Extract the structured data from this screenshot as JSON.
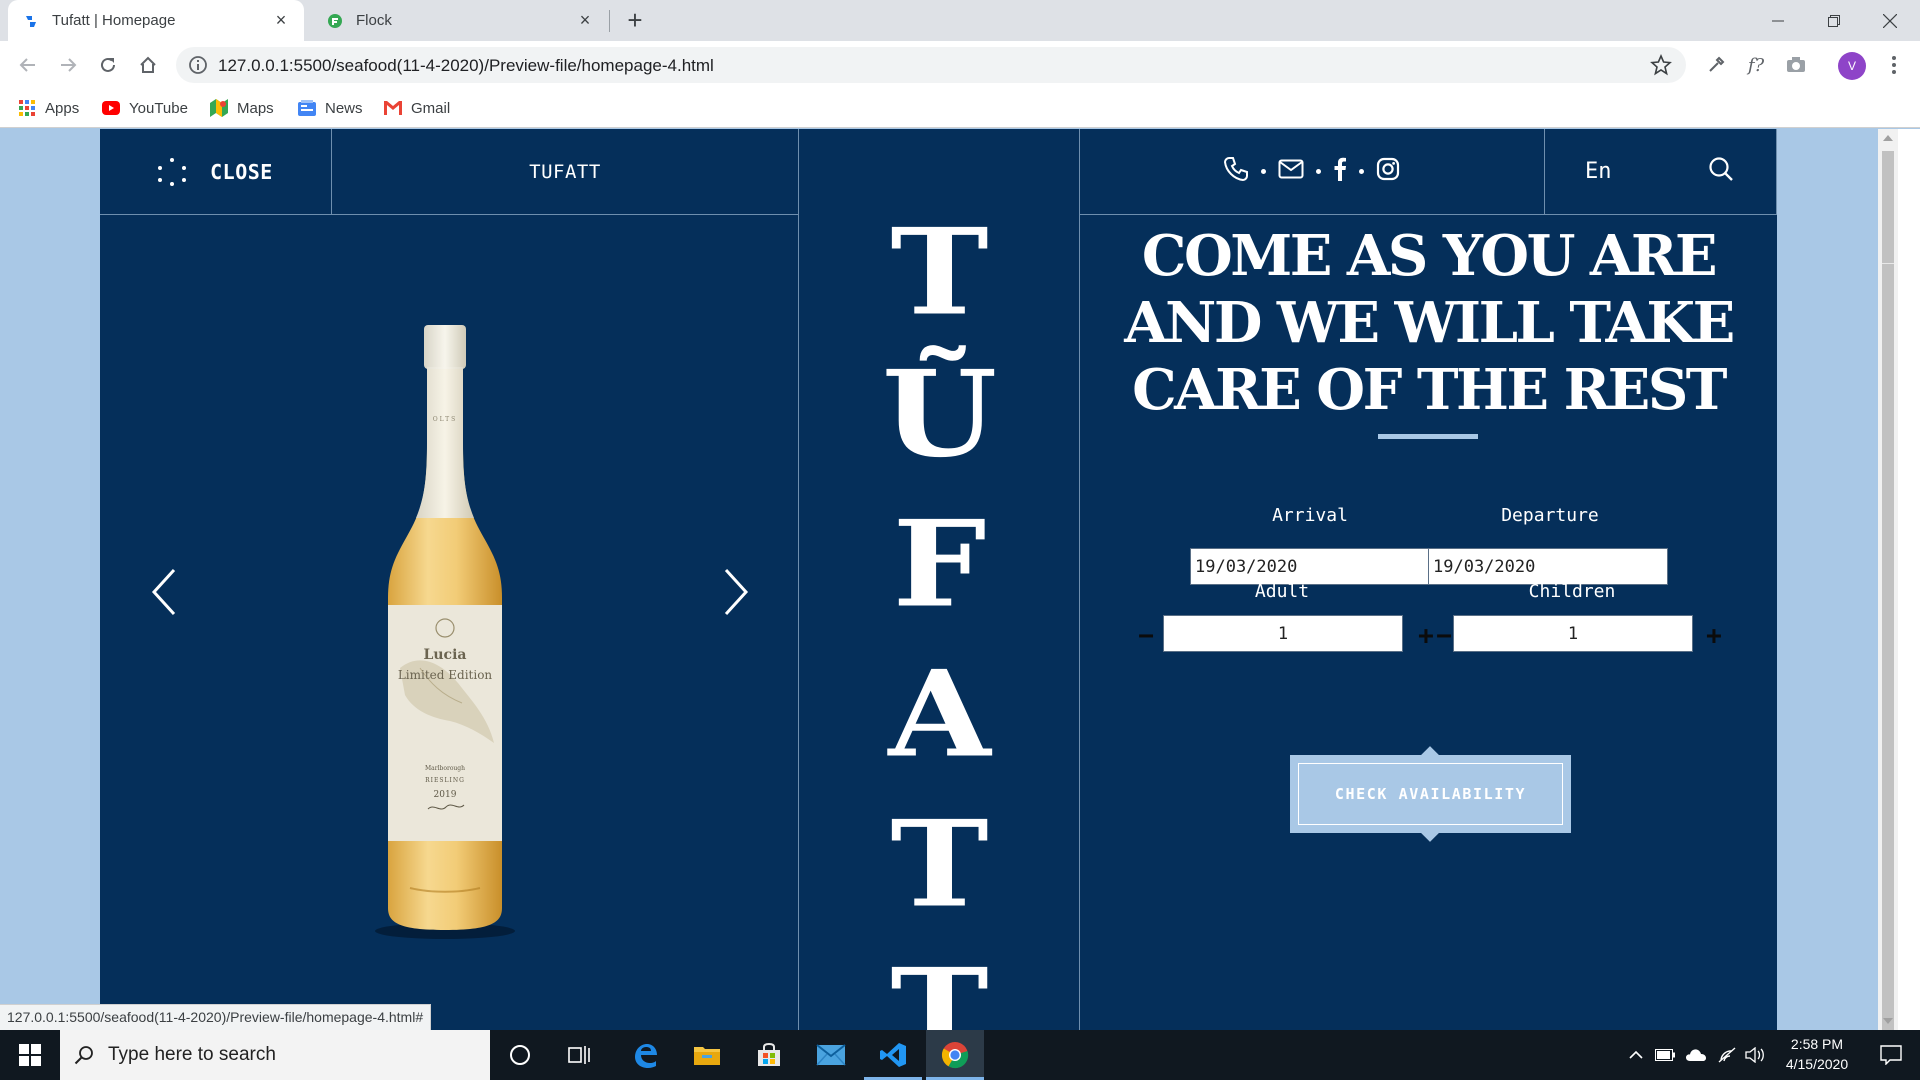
{
  "browser": {
    "tabs": [
      {
        "title": "Tufatt | Homepage",
        "active": true
      },
      {
        "title": "Flock",
        "active": false
      }
    ],
    "url": "127.0.0.1:5500/seafood(11-4-2020)/Preview-file/homepage-4.html",
    "status_url": "127.0.0.1:5500/seafood(11-4-2020)/Preview-file/homepage-4.html#",
    "profile_initial": "V",
    "extension_label": "f?",
    "bookmarks": [
      {
        "label": "Apps",
        "icon": "apps-grid-icon"
      },
      {
        "label": "YouTube",
        "icon": "youtube-icon"
      },
      {
        "label": "Maps",
        "icon": "maps-icon"
      },
      {
        "label": "News",
        "icon": "news-icon"
      },
      {
        "label": "Gmail",
        "icon": "gmail-icon"
      }
    ]
  },
  "site": {
    "header": {
      "close_label": "CLOSE",
      "brand": "TUFATT",
      "lang": "En",
      "contact_icons": [
        "phone-icon",
        "mail-icon",
        "facebook-icon",
        "instagram-icon"
      ]
    },
    "vertical_brand": [
      "T",
      "Ũ",
      "F",
      "A",
      "T",
      "T"
    ],
    "slider": {
      "product": {
        "name": "Lucia",
        "edition": "Limited Edition",
        "region": "Marlborough",
        "variety": "RIESLING",
        "year": "2019",
        "top_label": "OLTS"
      }
    },
    "booking": {
      "headline": "COME AS YOU ARE AND WE WILL TAKE CARE OF THE REST",
      "arrival_label": "Arrival",
      "departure_label": "Departure",
      "arrival_value": "19/03/2020",
      "departure_value": "19/03/2020",
      "adult_label": "Adult",
      "children_label": "Children",
      "adult_value": "1",
      "children_value": "1",
      "minus": "−",
      "plus": "+",
      "button": "CHECK AVAILABILITY"
    },
    "colors": {
      "navy": "#052f5a",
      "light_blue": "#a9c8e6",
      "white": "#ffffff"
    }
  },
  "taskbar": {
    "search_placeholder": "Type here to search",
    "time": "2:58 PM",
    "date": "4/15/2020"
  }
}
